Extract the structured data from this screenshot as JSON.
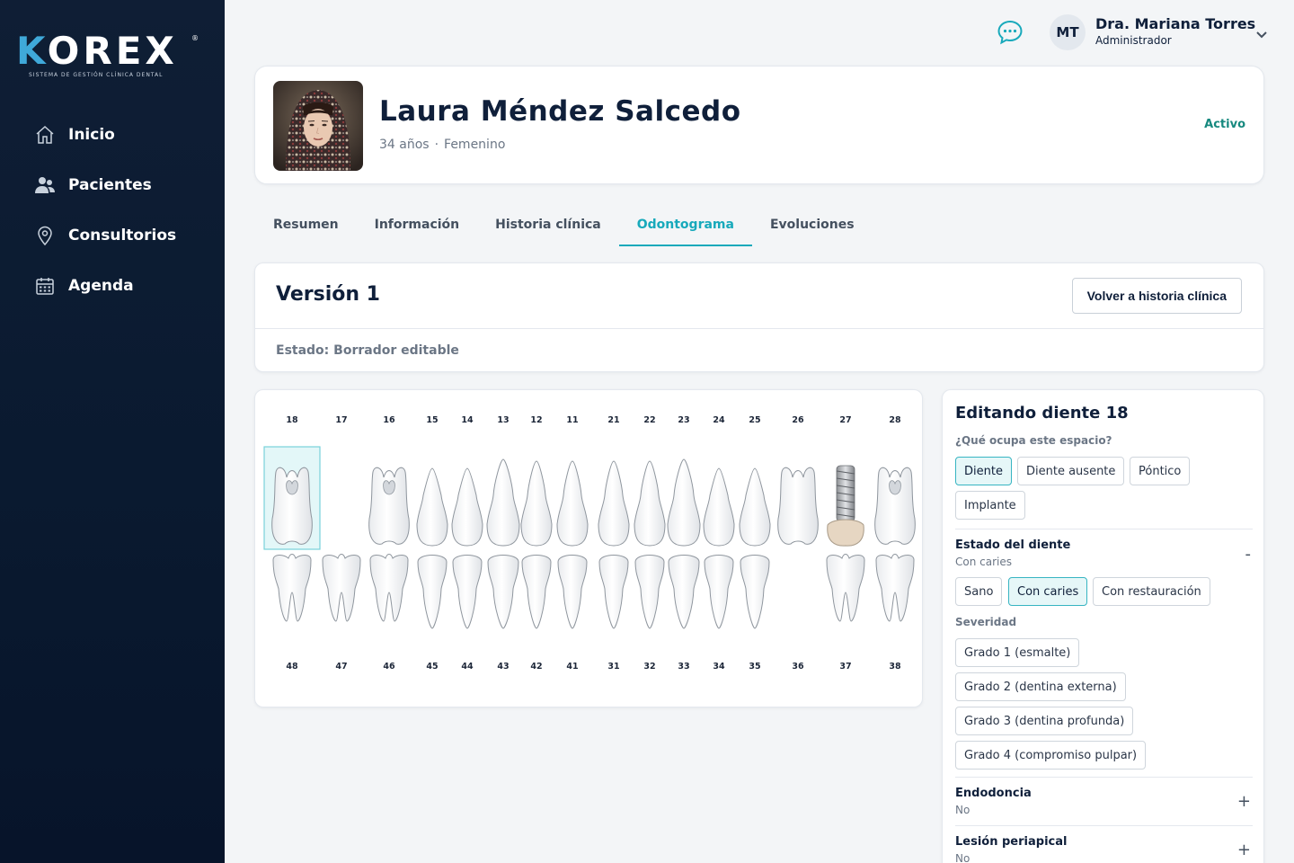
{
  "brand": {
    "name": "KOREX",
    "k": "K",
    "rest": "OREX",
    "reg": "®",
    "tagline": "SISTEMA DE GESTIÓN CLÍNICA DENTAL"
  },
  "sidebar": {
    "items": [
      {
        "label": "Inicio",
        "icon": "home-icon"
      },
      {
        "label": "Pacientes",
        "icon": "users-icon"
      },
      {
        "label": "Consultorios",
        "icon": "location-pin-icon"
      },
      {
        "label": "Agenda",
        "icon": "calendar-icon"
      }
    ]
  },
  "topbar": {
    "chat_icon": "chat-bubble-icon",
    "user": {
      "initials": "MT",
      "name": "Dra. Mariana Torres",
      "role": "Administrador"
    }
  },
  "patient": {
    "name": "Laura Méndez Salcedo",
    "age": "34 años",
    "separator": "·",
    "sex": "Femenino",
    "status": "Activo"
  },
  "tabs": [
    {
      "label": "Resumen",
      "active": false
    },
    {
      "label": "Información",
      "active": false
    },
    {
      "label": "Historia clínica",
      "active": false
    },
    {
      "label": "Odontograma",
      "active": true
    },
    {
      "label": "Evoluciones",
      "active": false
    }
  ],
  "version": {
    "title": "Versión 1",
    "back_button": "Volver a historia clínica",
    "state": "Estado: Borrador editable"
  },
  "odontogram": {
    "upper": [
      "18",
      "17",
      "16",
      "15",
      "14",
      "13",
      "12",
      "11",
      "21",
      "22",
      "23",
      "24",
      "25",
      "26",
      "27",
      "28"
    ],
    "lower": [
      "48",
      "47",
      "46",
      "45",
      "44",
      "43",
      "42",
      "41",
      "31",
      "32",
      "33",
      "34",
      "35",
      "36",
      "37",
      "38"
    ],
    "selected": "18",
    "implant": "27"
  },
  "editor": {
    "title": "Editando diente 18",
    "question": "¿Qué ocupa este espacio?",
    "occupancy": [
      "Diente",
      "Diente ausente",
      "Póntico",
      "Implante"
    ],
    "occupancy_selected": "Diente",
    "estado": {
      "title": "Estado del diente",
      "value": "Con caries",
      "toggle": "-",
      "options": [
        "Sano",
        "Con caries",
        "Con restauración"
      ],
      "severity_label": "Severidad",
      "severity": [
        "Grado 1 (esmalte)",
        "Grado 2 (dentina externa)",
        "Grado 3 (dentina profunda)",
        "Grado 4 (compromiso pulpar)"
      ]
    },
    "endodoncia": {
      "title": "Endodoncia",
      "value": "No",
      "toggle": "+"
    },
    "lesion": {
      "title": "Lesión periapical",
      "value": "No",
      "toggle": "+"
    }
  },
  "colors": {
    "accent": "#17a9bb",
    "status_active": "#17897f",
    "sidebar_bg": "#0f1e35"
  }
}
